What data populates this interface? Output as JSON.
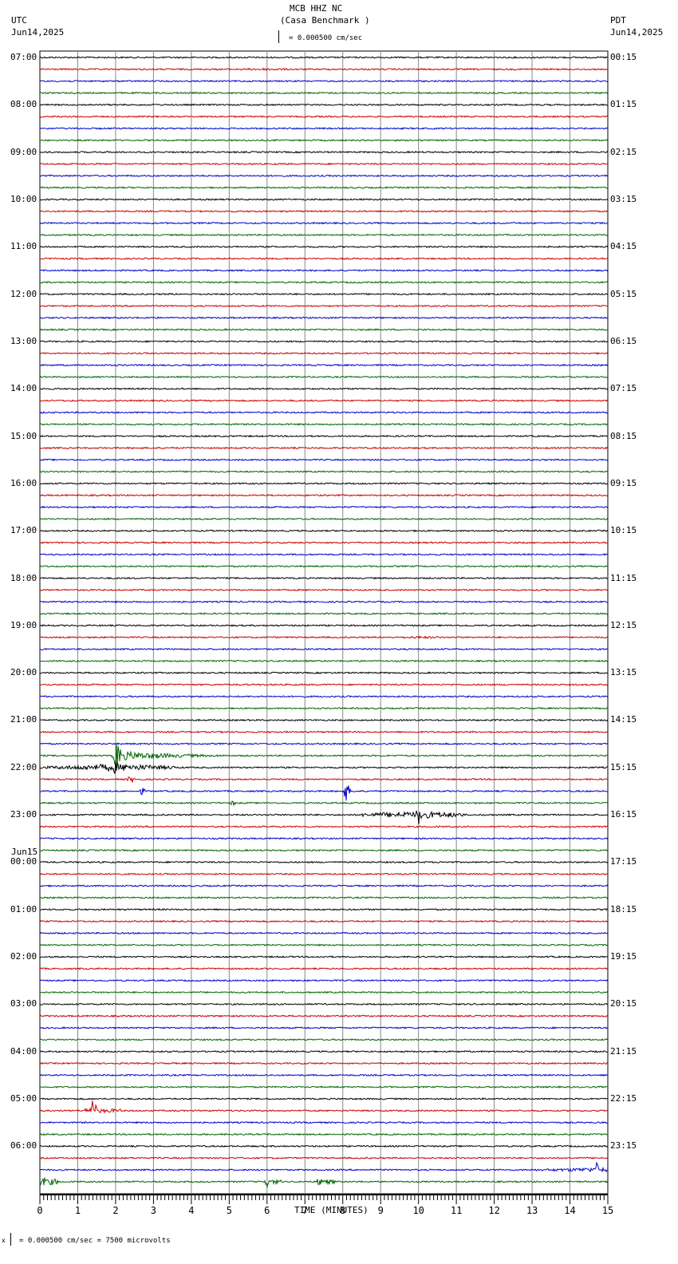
{
  "header": {
    "title": "MCB HHZ NC",
    "subtitle": "(Casa Benchmark )",
    "left_tz": "UTC",
    "left_date": "Jun14,2025",
    "right_tz": "PDT",
    "right_date": "Jun14,2025",
    "scale": "= 0.000500 cm/sec",
    "day_change": "Jun15"
  },
  "footer": {
    "scale": "= 0.000500 cm/sec =    7500 microvolts",
    "prefix": "x"
  },
  "chart_data": {
    "type": "line",
    "title": "MCB HHZ NC (Casa Benchmark )",
    "xlabel": "TIME (MINUTES)",
    "xlim": [
      0,
      15
    ],
    "x_ticks": [
      "0",
      "1",
      "2",
      "3",
      "4",
      "5",
      "6",
      "7",
      "8",
      "9",
      "10",
      "11",
      "12",
      "13",
      "14",
      "15"
    ],
    "trace_colors": [
      "#000000",
      "#cc0000",
      "#0000cc",
      "#006600"
    ],
    "traces_per_hour": 4,
    "left_labels": [
      "07:00",
      "08:00",
      "09:00",
      "10:00",
      "11:00",
      "12:00",
      "13:00",
      "14:00",
      "15:00",
      "16:00",
      "17:00",
      "18:00",
      "19:00",
      "20:00",
      "21:00",
      "22:00",
      "23:00",
      "00:00",
      "01:00",
      "02:00",
      "03:00",
      "04:00",
      "05:00",
      "06:00"
    ],
    "right_labels": [
      "00:15",
      "01:15",
      "02:15",
      "03:15",
      "04:15",
      "05:15",
      "06:15",
      "07:15",
      "08:15",
      "09:15",
      "10:15",
      "11:15",
      "12:15",
      "13:15",
      "14:15",
      "15:15",
      "16:15",
      "17:15",
      "18:15",
      "19:15",
      "20:15",
      "21:15",
      "22:15",
      "23:15"
    ],
    "events": [
      {
        "trace": 1,
        "start": 5,
        "end": 9,
        "peak": 6,
        "amp": 1.5
      },
      {
        "trace": 49,
        "start": 9.6,
        "end": 10.6,
        "peak": 10,
        "amp": 1.5
      },
      {
        "trace": 59,
        "start": 1.9,
        "end": 15,
        "peak": 2.05,
        "amp": 6,
        "spike": 28
      },
      {
        "trace": 60,
        "start": 0,
        "end": 3.6,
        "peak": 2.0,
        "amp": 5,
        "spike": 10
      },
      {
        "trace": 61,
        "start": 2.3,
        "end": 2.6,
        "peak": 2.4,
        "amp": 1,
        "spike": 6
      },
      {
        "trace": 62,
        "start": 8.0,
        "end": 8.3,
        "peak": 8.1,
        "amp": 2,
        "spike": 14
      },
      {
        "trace": 62,
        "start": 2.6,
        "end": 3.3,
        "peak": 2.7,
        "amp": 1,
        "spike": 5
      },
      {
        "trace": 63,
        "start": 5.0,
        "end": 5.2,
        "peak": 5.1,
        "amp": 1,
        "spike": 4
      },
      {
        "trace": 64,
        "start": 8.5,
        "end": 11.2,
        "peak": 10.0,
        "amp": 5,
        "spike": 14
      },
      {
        "trace": 89,
        "start": 1.2,
        "end": 2.2,
        "peak": 1.4,
        "amp": 3,
        "spike": 24
      },
      {
        "trace": 94,
        "start": 12.3,
        "end": 15,
        "peak": 14.7,
        "amp": 3,
        "spike": 10
      },
      {
        "trace": 95,
        "start": 0,
        "end": 0.5,
        "peak": 0.15,
        "amp": 4,
        "spike": 9
      },
      {
        "trace": 95,
        "start": 5.9,
        "end": 6.4,
        "peak": 6.0,
        "amp": 3,
        "spike": 7
      },
      {
        "trace": 95,
        "start": 7.3,
        "end": 7.8,
        "peak": 7.4,
        "amp": 3,
        "spike": 8
      }
    ]
  }
}
